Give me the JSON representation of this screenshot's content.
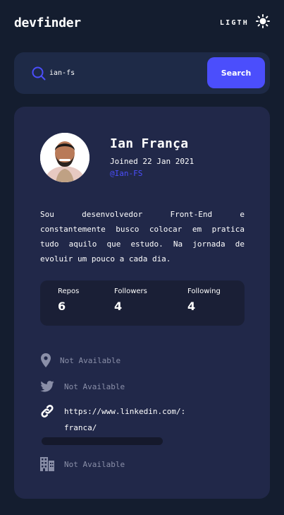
{
  "header": {
    "logo": "devfinder",
    "theme_label": "LIGTH",
    "theme_icon": "sun-icon"
  },
  "search": {
    "value": "ian-fs",
    "button_label": "Search",
    "icon": "search-icon"
  },
  "profile": {
    "name": "Ian França",
    "joined": "Joined 22 Jan 2021",
    "login": "@Ian-FS",
    "bio": "Sou desenvolvedor Front-End e constantemente busco colocar em pratica tudo aquilo que estudo. Na jornada de evoluir um pouco a cada dia."
  },
  "stats": {
    "repos_label": "Repos",
    "repos_value": "6",
    "followers_label": "Followers",
    "followers_value": "4",
    "following_label": "Following",
    "following_value": "4"
  },
  "links": {
    "location": "Not Available",
    "twitter": "Not Available",
    "website_line1": "https://www.linkedin.com/:",
    "website_line2": "franca/",
    "company": "Not Available"
  },
  "colors": {
    "background": "#141D2F",
    "card": "#212849",
    "accent": "#4B4EFC",
    "muted": "#8A8FA8"
  }
}
